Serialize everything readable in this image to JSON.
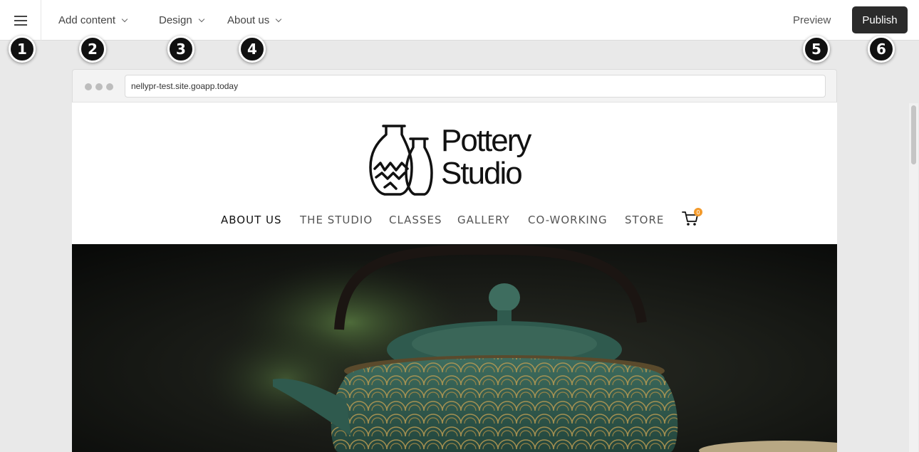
{
  "toolbar": {
    "add_content": "Add content",
    "design": "Design",
    "about_us": "About us",
    "preview": "Preview",
    "publish": "Publish"
  },
  "badges": [
    "1",
    "2",
    "3",
    "4",
    "5",
    "6"
  ],
  "browser": {
    "url": "nellypr-test.site.goapp.today"
  },
  "site": {
    "logo_line1": "Pottery",
    "logo_line2": "Studio",
    "nav": [
      "ABOUT US",
      "THE STUDIO",
      "CLASSES",
      "GALLERY",
      "CO-WORKING",
      "STORE"
    ],
    "cart_count": "0"
  },
  "colors": {
    "publish_bg": "#2b2b2b",
    "cart_badge": "#f39a2b",
    "hero_bg": "#0d0f0c"
  },
  "icons": {
    "menu": "hamburger-icon",
    "cart": "cart-icon",
    "logo": "vase-icon"
  }
}
